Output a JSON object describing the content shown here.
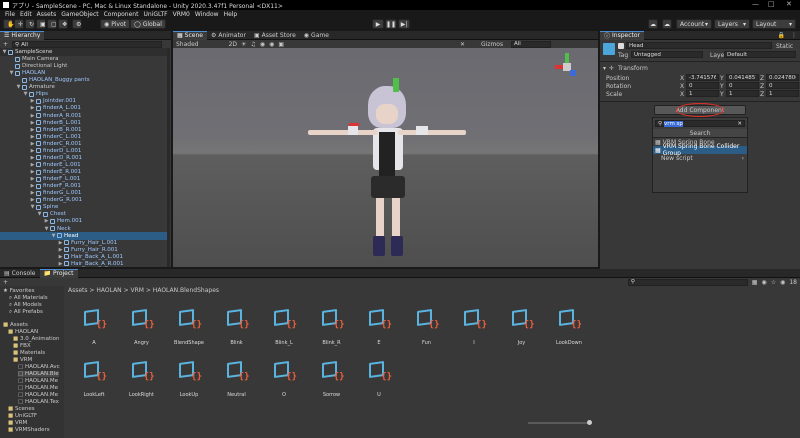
{
  "title_bar": {
    "text": "アプリ - SampleScene - PC, Mac & Linux Standalone - Unity 2020.3.47f1 Personal <DX11>"
  },
  "menu": [
    "File",
    "Edit",
    "Assets",
    "GameObject",
    "Component",
    "UniGLTF",
    "VRM0",
    "Window",
    "Help"
  ],
  "toolbar": {
    "pivot": "Pivot",
    "global": "Global",
    "account": "Account",
    "layers": "Layers",
    "layout": "Layout"
  },
  "hierarchy": {
    "tab": "Hierarchy",
    "add_label": "+",
    "search_placeholder": "All",
    "items": [
      {
        "label": "SampleScene",
        "level": 0,
        "arrow": "▼",
        "type": "scene"
      },
      {
        "label": "Main Camera",
        "level": 1,
        "arrow": "",
        "type": "obj"
      },
      {
        "label": "Directional Light",
        "level": 1,
        "arrow": "",
        "type": "obj"
      },
      {
        "label": "HAOLAN",
        "level": 1,
        "arrow": "▼",
        "type": "prefab"
      },
      {
        "label": "HAOLAN_Buggy pants",
        "level": 2,
        "arrow": "",
        "type": "prefab"
      },
      {
        "label": "Armature",
        "level": 2,
        "arrow": "▼",
        "type": "obj"
      },
      {
        "label": "Hips",
        "level": 3,
        "arrow": "▼",
        "type": "obj"
      },
      {
        "label": "Jointder.001",
        "level": 4,
        "arrow": "▶",
        "type": "obj"
      },
      {
        "label": "finderA_L.001",
        "level": 4,
        "arrow": "▶",
        "type": "obj"
      },
      {
        "label": "finderA_R.001",
        "level": 4,
        "arrow": "▶",
        "type": "obj"
      },
      {
        "label": "finderB_L.001",
        "level": 4,
        "arrow": "▶",
        "type": "obj"
      },
      {
        "label": "finderB_R.001",
        "level": 4,
        "arrow": "▶",
        "type": "obj"
      },
      {
        "label": "finderC_L.001",
        "level": 4,
        "arrow": "▶",
        "type": "obj"
      },
      {
        "label": "finderC_R.001",
        "level": 4,
        "arrow": "▶",
        "type": "obj"
      },
      {
        "label": "finderD_L.001",
        "level": 4,
        "arrow": "▶",
        "type": "obj"
      },
      {
        "label": "finderD_R.001",
        "level": 4,
        "arrow": "▶",
        "type": "obj"
      },
      {
        "label": "finderE_L.001",
        "level": 4,
        "arrow": "▶",
        "type": "obj"
      },
      {
        "label": "finderE_R.001",
        "level": 4,
        "arrow": "▶",
        "type": "obj"
      },
      {
        "label": "finderF_L.001",
        "level": 4,
        "arrow": "▶",
        "type": "obj"
      },
      {
        "label": "finderF_R.001",
        "level": 4,
        "arrow": "▶",
        "type": "obj"
      },
      {
        "label": "finderG_L.001",
        "level": 4,
        "arrow": "▶",
        "type": "obj"
      },
      {
        "label": "finderG_R.001",
        "level": 4,
        "arrow": "▶",
        "type": "obj"
      },
      {
        "label": "Spine",
        "level": 4,
        "arrow": "▼",
        "type": "obj"
      },
      {
        "label": "Chest",
        "level": 5,
        "arrow": "▼",
        "type": "obj"
      },
      {
        "label": "Hem.001",
        "level": 6,
        "arrow": "▶",
        "type": "obj"
      },
      {
        "label": "Neck",
        "level": 6,
        "arrow": "▼",
        "type": "obj"
      },
      {
        "label": "Head",
        "level": 7,
        "arrow": "▼",
        "type": "obj",
        "selected": true
      },
      {
        "label": "Furry_Hair_L.001",
        "level": 8,
        "arrow": "▶",
        "type": "obj"
      },
      {
        "label": "Furry_Hair_R.001",
        "level": 8,
        "arrow": "▶",
        "type": "obj"
      },
      {
        "label": "Hair_Back_A_L.001",
        "level": 8,
        "arrow": "▶",
        "type": "obj"
      },
      {
        "label": "Hair_Back_A_R.001",
        "level": 8,
        "arrow": "▶",
        "type": "obj"
      },
      {
        "label": "Hair_Back_B_L.001",
        "level": 8,
        "arrow": "▶",
        "type": "obj"
      },
      {
        "label": "Hair_Back_B_R.001",
        "level": 8,
        "arrow": "▶",
        "type": "obj"
      }
    ]
  },
  "scene": {
    "tabs": [
      "Scene",
      "Animator",
      "Asset Store",
      "Game"
    ],
    "shading": "Shaded",
    "mode": "2D",
    "gizmos": "Gizmos",
    "gizmo_search": "All"
  },
  "inspector": {
    "tab": "Inspector",
    "name": "Head",
    "static": "Static",
    "tag_label": "Tag",
    "tag_value": "Untagged",
    "layer_label": "Layer",
    "layer_value": "Default",
    "transform_title": "Transform",
    "position": {
      "label": "Position",
      "x": "-3.741576e-",
      "y": "0.04148579",
      "z": "0.02478065"
    },
    "rotation": {
      "label": "Rotation",
      "x": "0",
      "y": "0",
      "z": "0"
    },
    "scale": {
      "label": "Scale",
      "x": "1",
      "y": "1",
      "z": "1"
    },
    "add_component": "Add Component",
    "search_value": "vrm sp",
    "search_title": "Search",
    "results": [
      "VRM Spring Bone",
      "VRM Spring Bone Collider Group"
    ],
    "new_script": "New script"
  },
  "project": {
    "tabs": [
      "Console",
      "Project"
    ],
    "breadcrumb": "Assets > HAOLAN > VRM > HAOLAN.BlendShapes",
    "favorites": [
      "Favorites",
      "All Materials",
      "All Models",
      "All Prefabs"
    ],
    "tree": [
      "Assets",
      "HAOLAN",
      "3.0_Animation",
      "FBX",
      "Materials",
      "VRM",
      "HAOLAN.Avc",
      "HAOLAN.Ble",
      "HAOLAN.Me",
      "HAOLAN.Me",
      "HAOLAN.Me",
      "HAOLAN.Tex",
      "Scenes",
      "UniGLTF",
      "VRM",
      "VRMShaders"
    ],
    "assets": [
      "A",
      "Angry",
      "BlendShape",
      "Blink",
      "Blink_L",
      "Blink_R",
      "E",
      "Fun",
      "I",
      "Joy",
      "LookDown",
      "LookLeft",
      "LookRight",
      "LookUp",
      "Neutral",
      "O",
      "Sorrow",
      "U"
    ],
    "count": "18"
  }
}
